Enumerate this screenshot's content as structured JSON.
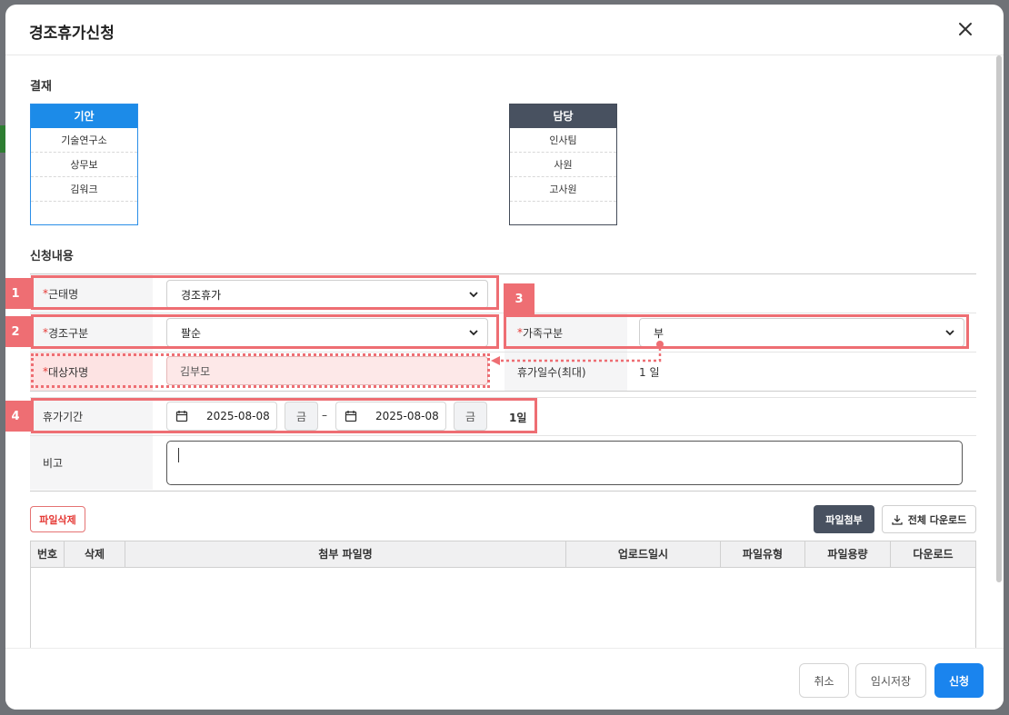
{
  "modal": {
    "title": "경조휴가신청"
  },
  "approval": {
    "section_title": "결재",
    "drafter": {
      "header": "기안",
      "rows": [
        "기술연구소",
        "상무보",
        "김워크"
      ]
    },
    "manager": {
      "header": "담당",
      "rows": [
        "인사팀",
        "사원",
        "고사원"
      ]
    }
  },
  "application": {
    "section_title": "신청내용",
    "leave_name": {
      "required": "*",
      "label": "근태명",
      "value": "경조휴가"
    },
    "event_type": {
      "required": "*",
      "label": "경조구분",
      "value": "팔순"
    },
    "family_type": {
      "required": "*",
      "label": "가족구분",
      "value": "부"
    },
    "target_name": {
      "required": "*",
      "label": "대상자명",
      "value": "김부모"
    },
    "max_days": {
      "label": "휴가일수(최대)",
      "value": "1 일"
    },
    "period": {
      "label": "휴가기간",
      "start_date": "2025-08-08",
      "start_day": "금",
      "separator": "–",
      "end_date": "2025-08-08",
      "end_day": "금",
      "total": "1일"
    },
    "note": {
      "label": "비고",
      "value": ""
    }
  },
  "annotations": [
    "1",
    "2",
    "3",
    "4"
  ],
  "files": {
    "delete_button": "파일삭제",
    "attach_button": "파일첨부",
    "download_all_button": "전체 다운로드",
    "columns": [
      "번호",
      "삭제",
      "첨부 파일명",
      "업로드일시",
      "파일유형",
      "파일용량",
      "다운로드"
    ]
  },
  "footer": {
    "cancel": "취소",
    "save_draft": "임시저장",
    "submit": "신청"
  },
  "colors": {
    "primary": "#1a84ee",
    "annotation": "#ee6e73",
    "dark": "#485160",
    "required": "#e53935"
  }
}
